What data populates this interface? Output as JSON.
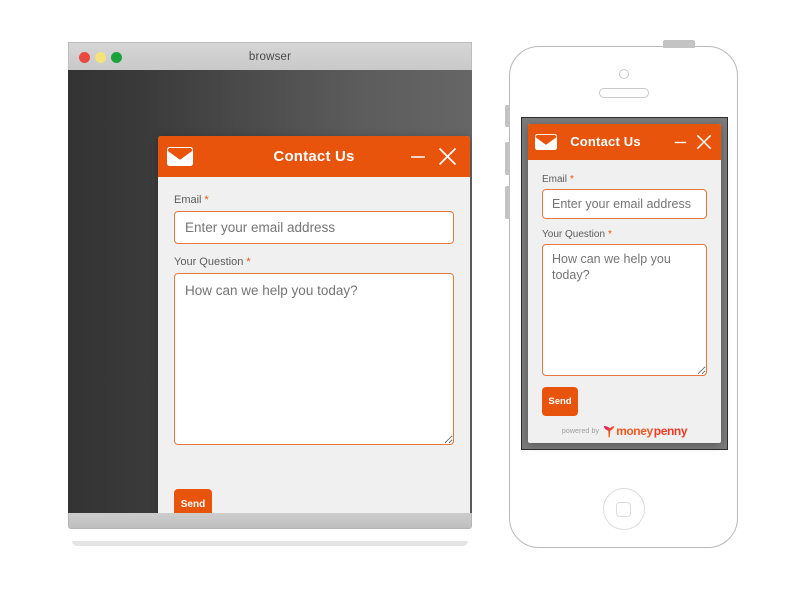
{
  "browser": {
    "window_title": "browser",
    "traffic_lights": [
      {
        "name": "close-dot",
        "color": "#e8483f"
      },
      {
        "name": "minimize-dot",
        "color": "#f5e27a"
      },
      {
        "name": "zoom-dot",
        "color": "#1ba23c"
      }
    ]
  },
  "widget": {
    "title": "Contact Us",
    "mail_icon": "envelope-icon",
    "minimize_icon": "minimize-icon",
    "close_icon": "close-icon",
    "email": {
      "label": "Email",
      "required_marker": "*",
      "placeholder": "Enter your email address",
      "value": ""
    },
    "question": {
      "label": "Your Question",
      "required_marker": "*",
      "placeholder": "How can we help you today?",
      "value": ""
    },
    "send_label": "Send",
    "footer": {
      "powered_by": "powered by",
      "brand_first": "money",
      "brand_second": "penny",
      "brand_icon": "bird-logo-icon"
    }
  },
  "phone": {
    "camera_icon": "front-camera-icon",
    "speaker_icon": "earpiece-speaker-icon",
    "home_button_icon": "home-button-icon",
    "power_button_icon": "power-button-icon",
    "side_buttons": [
      "mute-switch-icon",
      "volume-up-icon",
      "volume-down-icon"
    ]
  },
  "colors": {
    "accent": "#e8540c",
    "field_border": "#e8773c",
    "placeholder": "#b0b0b0",
    "label": "#5c5c5c",
    "widget_bg": "#f0f0f0",
    "brand_magenta": "#e5007d"
  }
}
